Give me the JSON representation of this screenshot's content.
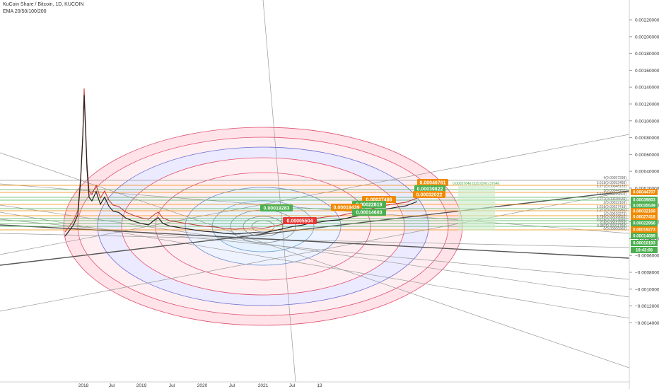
{
  "header": {
    "title": "KuCoin Share / Bitcoin, 1D, KUCOIN",
    "indicator": "EMA 20/50/100/200"
  },
  "chart_data": {
    "type": "line",
    "symbol": "KCS/BTC",
    "y_ticks": [
      "0.00220000",
      "0.00200000",
      "0.00180000",
      "0.00160000",
      "0.00140000",
      "0.00120000",
      "0.00100000",
      "0.00080000",
      "0.00060000",
      "0.00040000",
      "0.00020000",
      "0.00000000",
      "−0.00020000",
      "−0.00040000",
      "−0.00060000",
      "−0.00080000",
      "−0.00100000",
      "−0.00120000",
      "−0.00140000"
    ],
    "x_ticks": [
      "2018",
      "Jul",
      "2019",
      "Jul",
      "2020",
      "Jul",
      "2021",
      "Jul",
      "13"
    ],
    "ylim": [
      -0.0014,
      0.0022
    ],
    "price_tags": [
      {
        "text": "0.00044707",
        "color": "#ef8a00"
      },
      {
        "text": "0.00039803",
        "color": "#4caf50"
      },
      {
        "text": "0.00035539",
        "color": "#4caf50"
      },
      {
        "text": "0.00032169",
        "color": "#ef8a00"
      },
      {
        "text": "0.00027418",
        "color": "#ef8a00"
      },
      {
        "text": "0.00022956",
        "color": "#4caf50"
      },
      {
        "text": "0.00019273",
        "color": "#ef8a00"
      },
      {
        "text": "0.00014689",
        "color": "#4caf50"
      },
      {
        "text": "0.00010193",
        "color": "#4caf50"
      },
      {
        "text": "18:43:08",
        "color": "#4caf50"
      }
    ],
    "annotations": [
      {
        "text": "0.00046761",
        "color": "#ef8a00"
      },
      {
        "text": "0.00039822",
        "color": "#4caf50"
      },
      {
        "text": "0.00032022",
        "color": "#ef8a00"
      },
      {
        "text": "0.00037486",
        "color": "#ef8a00"
      },
      {
        "text": "0.00022819",
        "color": "#4caf50"
      },
      {
        "text": "0.00019439",
        "color": "#ef8a00"
      },
      {
        "text": "0.00019283",
        "color": "#4caf50"
      },
      {
        "text": "0.00014603",
        "color": "#4caf50"
      },
      {
        "text": "0.00005504",
        "color": "#e53935"
      }
    ],
    "fib_labels": [
      "4(0.00057298)",
      "3.618(0.00052488)",
      "3.272(0.00048133)",
      "3(0.00044707)",
      "2.618(0.00039803)",
      "2.272(0.00035539)",
      "2(0.00032169)",
      "1.618(0.00027418)",
      "1.272(0.00022956)",
      "1(0.00019273)",
      "0.786(0.00016653)",
      "0.618(0.00014689)",
      "0.5(0.00013219)",
      "0.382(0.00011759)",
      "0(0.00006965)"
    ],
    "projection_text": "0.00037646 (529.09%) 37646"
  }
}
